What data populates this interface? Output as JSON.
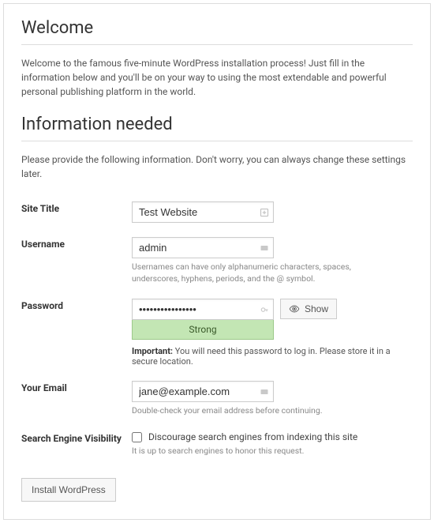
{
  "headings": {
    "welcome": "Welcome",
    "info_needed": "Information needed"
  },
  "intro_text": "Welcome to the famous five-minute WordPress installation process! Just fill in the information below and you'll be on your way to using the most extendable and powerful personal publishing platform in the world.",
  "info_desc": "Please provide the following information. Don't worry, you can always change these settings later.",
  "fields": {
    "site_title": {
      "label": "Site Title",
      "value": "Test Website"
    },
    "username": {
      "label": "Username",
      "value": "admin",
      "hint": "Usernames can have only alphanumeric characters, spaces, underscores, hyphens, periods, and the @ symbol."
    },
    "password": {
      "label": "Password",
      "value": "••••••••••••••••",
      "strength": "Strong",
      "show_label": "Show",
      "important_label": "Important:",
      "important_text": " You will need this password to log in. Please store it in a secure location."
    },
    "email": {
      "label": "Your Email",
      "value": "jane@example.com",
      "hint": "Double-check your email address before continuing."
    },
    "search": {
      "label": "Search Engine Visibility",
      "checkbox_label": "Discourage search engines from indexing this site",
      "hint": "It is up to search engines to honor this request."
    }
  },
  "submit_label": "Install WordPress"
}
